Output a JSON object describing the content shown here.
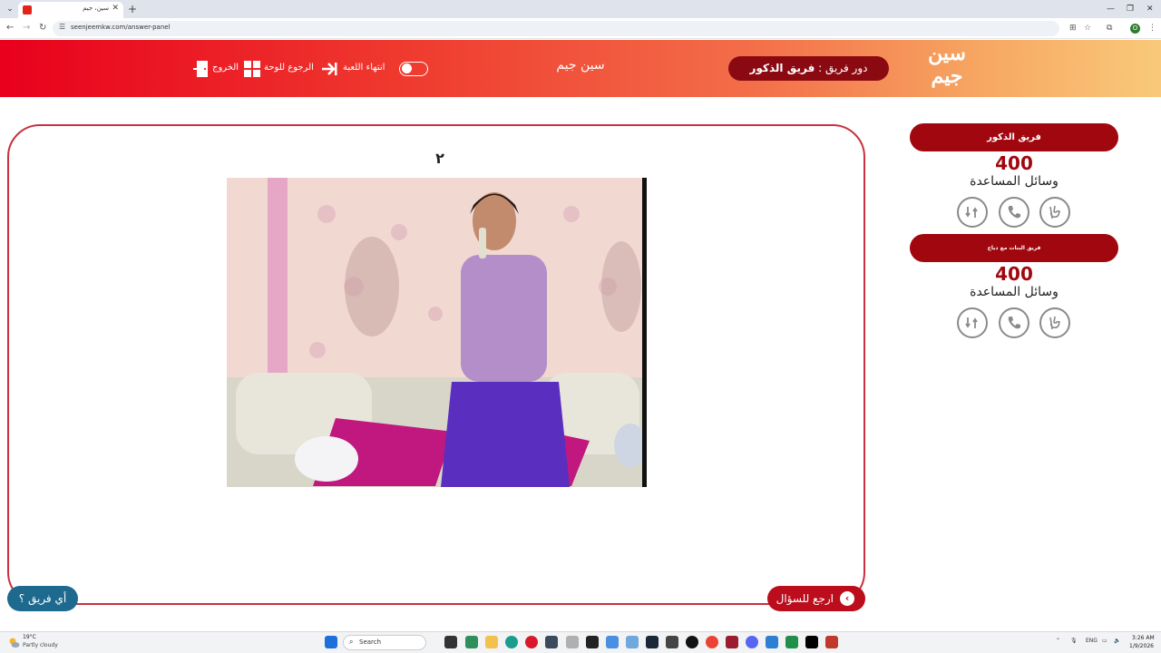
{
  "browser": {
    "tab_title": "سين، جيم",
    "url": "seenjeemkw.com/answer-panel",
    "profile_initial": "O"
  },
  "header": {
    "logo_line1": "سين",
    "logo_line2": "جيم",
    "turn_prefix": "دور فريق :",
    "turn_team": "فريق الذكور",
    "game_title": "سين جيم",
    "end_game_label": "انتهاء اللعبة",
    "back_to_board_label": "الرجوع للوحة",
    "exit_label": "الخروج"
  },
  "question": {
    "number": "٢"
  },
  "buttons": {
    "back_to_question": "ارجع للسؤال",
    "which_team": "أي فريق ؟"
  },
  "teams": [
    {
      "name": "فريق الذكور",
      "score": "400",
      "helpers_label": "وسائل المساعدة"
    },
    {
      "name": "فريق البنات مع دياج",
      "score": "400",
      "helpers_label": "وسائل المساعدة"
    }
  ],
  "taskbar": {
    "weather_temp": "19°C",
    "weather_desc": "Partly cloudy",
    "search_placeholder": "Search",
    "lang": "ENG",
    "time": "3:26 AM",
    "date": "1/9/2026"
  },
  "colors": {
    "brand_red": "#a1070f",
    "header_gradient_start": "#e8001c",
    "header_gradient_end": "#f9c97a",
    "panel_border": "#c8323e",
    "which_team_blue": "#1d6a8e"
  }
}
